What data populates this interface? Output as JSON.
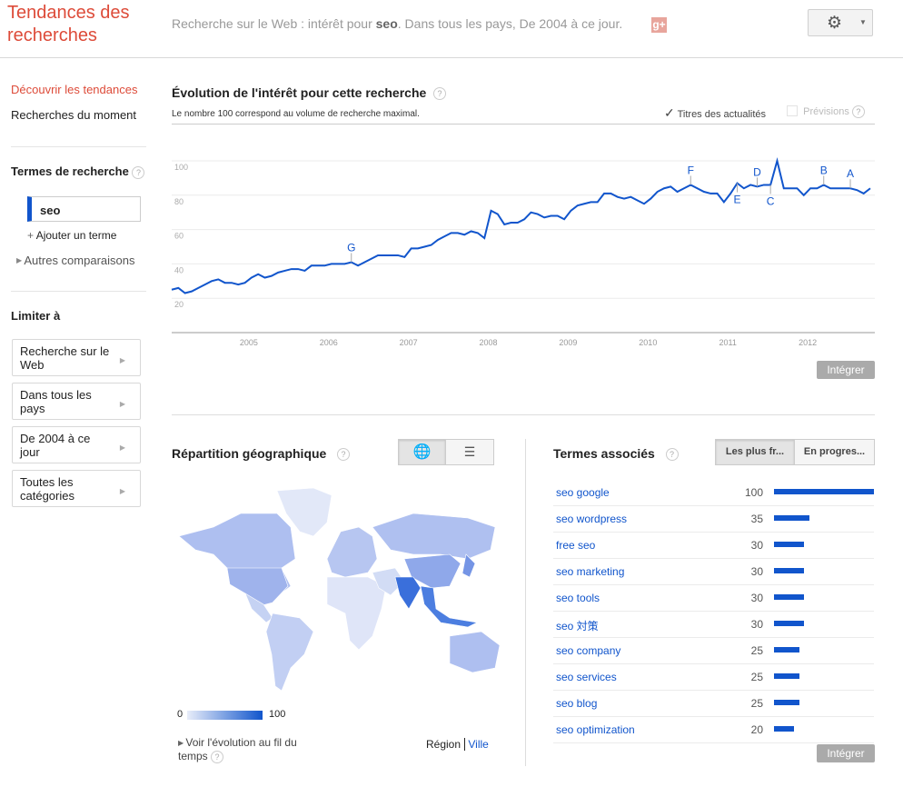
{
  "header": {
    "logo": "Tendances des recherches",
    "subtitle_prefix": "Recherche sur le Web : intérêt pour ",
    "subtitle_term": "seo",
    "subtitle_suffix": ". Dans tous les pays, De 2004 à ce jour.",
    "gplus": "g+",
    "settings_icon": "gear-icon"
  },
  "sidebar": {
    "nav": [
      "Découvrir les tendances",
      "Recherches du moment"
    ],
    "terms_heading": "Termes de recherche",
    "term": "seo",
    "add_term": "Ajouter un terme",
    "other_comparisons": "Autres comparaisons",
    "limit_heading": "Limiter à",
    "filters": [
      "Recherche sur le Web",
      "Dans tous les pays",
      "De 2004 à ce jour",
      "Toutes les catégories"
    ]
  },
  "interest": {
    "title": "Évolution de l'intérêt pour cette recherche",
    "subtitle": "Le nombre 100 correspond au volume de recherche maximal.",
    "news_headlines": "Titres des actualités",
    "news_checked": true,
    "forecast": "Prévisions",
    "forecast_checked": false,
    "embed": "Intégrer"
  },
  "chart_data": {
    "type": "line",
    "series_color": "#1155cc",
    "start": "2004-01",
    "interval": "month",
    "ylim": [
      0,
      100
    ],
    "yticks": [
      20,
      40,
      60,
      80,
      100
    ],
    "xticks": [
      "2005",
      "2006",
      "2007",
      "2008",
      "2009",
      "2010",
      "2011",
      "2012"
    ],
    "grid": true,
    "values": [
      25,
      26,
      23,
      24,
      26,
      28,
      30,
      31,
      29,
      29,
      28,
      29,
      32,
      34,
      32,
      33,
      35,
      36,
      37,
      37,
      36,
      39,
      39,
      39,
      40,
      40,
      40,
      41,
      39,
      41,
      43,
      45,
      45,
      45,
      45,
      44,
      49,
      49,
      50,
      51,
      54,
      56,
      58,
      58,
      57,
      59,
      58,
      55,
      71,
      69,
      63,
      64,
      64,
      66,
      70,
      69,
      67,
      68,
      68,
      66,
      71,
      74,
      75,
      76,
      76,
      81,
      81,
      79,
      78,
      79,
      77,
      75,
      78,
      82,
      84,
      85,
      82,
      84,
      86,
      84,
      82,
      81,
      81,
      76,
      81,
      87,
      84,
      86,
      85,
      86,
      86,
      100,
      84,
      84,
      84,
      80,
      84,
      84,
      86,
      84,
      84,
      84,
      84,
      83,
      81,
      84
    ],
    "annotations": [
      {
        "label": "G",
        "date": "2006-04"
      },
      {
        "label": "F",
        "date": "2010-07"
      },
      {
        "label": "E",
        "date": "2011-02"
      },
      {
        "label": "D",
        "date": "2011-05"
      },
      {
        "label": "C",
        "date": "2011-07"
      },
      {
        "label": "B",
        "date": "2012-03"
      },
      {
        "label": "A",
        "date": "2012-07"
      }
    ]
  },
  "geo": {
    "title": "Répartition géographique",
    "view_map_icon": "globe-icon",
    "view_list_icon": "list-icon",
    "legend_min": "0",
    "legend_max": "100",
    "legend_colors": [
      "#e8edf9",
      "#1155cc"
    ],
    "time_link": "Voir l'évolution au fil du temps",
    "region": "Région",
    "city": "Ville"
  },
  "related": {
    "title": "Termes associés",
    "tab_top": "Les plus fr...",
    "tab_rising": "En progres...",
    "embed": "Intégrer",
    "items": [
      {
        "term": "seo google",
        "value": 100
      },
      {
        "term": "seo wordpress",
        "value": 35
      },
      {
        "term": "free seo",
        "value": 30
      },
      {
        "term": "seo marketing",
        "value": 30
      },
      {
        "term": "seo tools",
        "value": 30
      },
      {
        "term": "seo 対策",
        "value": 30
      },
      {
        "term": "seo company",
        "value": 25
      },
      {
        "term": "seo services",
        "value": 25
      },
      {
        "term": "seo blog",
        "value": 25
      },
      {
        "term": "seo optimization",
        "value": 20
      }
    ]
  }
}
